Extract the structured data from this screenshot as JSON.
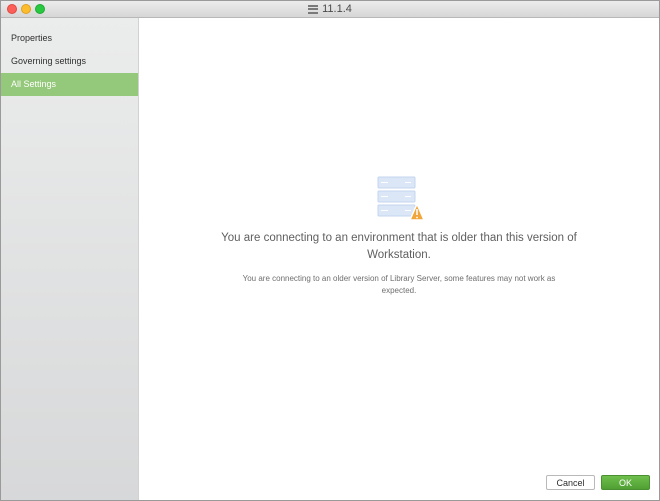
{
  "window": {
    "title": "11.1.4"
  },
  "sidebar": {
    "items": [
      {
        "label": "Properties",
        "selected": false
      },
      {
        "label": "Governing settings",
        "selected": false
      },
      {
        "label": "All Settings",
        "selected": true
      }
    ]
  },
  "main": {
    "icon": "server-warning-icon",
    "title": "You are connecting to an environment that is older than this version of Workstation.",
    "subtitle": "You are connecting to an older version of Library Server, some features may not work as expected."
  },
  "footer": {
    "cancel_label": "Cancel",
    "ok_label": "OK"
  },
  "colors": {
    "accent": "#94c87a",
    "ok_button": "#5dac3d",
    "warning": "#f0a63a"
  }
}
